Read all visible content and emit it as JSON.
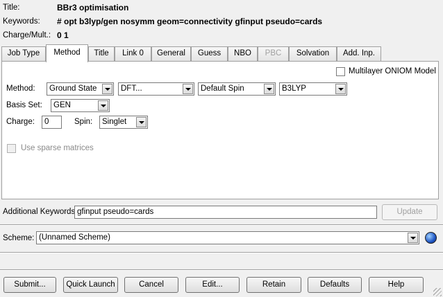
{
  "header": {
    "title_label": "Title:",
    "title_value": "BBr3 optimisation",
    "keywords_label": "Keywords:",
    "keywords_value": "# opt b3lyp/gen nosymm geom=connectivity gfinput pseudo=cards",
    "charge_label": "Charge/Mult.:",
    "charge_value": "0 1"
  },
  "tabs": [
    {
      "label": "Job Type",
      "state": "normal"
    },
    {
      "label": "Method",
      "state": "active"
    },
    {
      "label": "Title",
      "state": "normal"
    },
    {
      "label": "Link 0",
      "state": "normal"
    },
    {
      "label": "General",
      "state": "normal"
    },
    {
      "label": "Guess",
      "state": "normal"
    },
    {
      "label": "NBO",
      "state": "normal"
    },
    {
      "label": "PBC",
      "state": "disabled"
    },
    {
      "label": "Solvation",
      "state": "normal"
    },
    {
      "label": "Add. Inp.",
      "state": "normal"
    }
  ],
  "method_panel": {
    "oniom_label": "Multilayer ONIOM Model",
    "method_label": "Method:",
    "method_combos": [
      "Ground State",
      "DFT...",
      "Default Spin",
      "B3LYP"
    ],
    "basis_label": "Basis Set:",
    "basis_value": "GEN",
    "charge_label": "Charge:",
    "charge_value": "0",
    "spin_label": "Spin:",
    "spin_value": "Singlet",
    "sparse_label": "Use sparse matrices"
  },
  "additional": {
    "label": "Additional Keywords:",
    "value": "gfinput pseudo=cards",
    "update_button": "Update"
  },
  "scheme": {
    "label": "Scheme:",
    "value": "(Unnamed Scheme)"
  },
  "buttons": [
    "Submit...",
    "Quick Launch",
    "Cancel",
    "Edit...",
    "Retain",
    "Defaults",
    "Help"
  ]
}
